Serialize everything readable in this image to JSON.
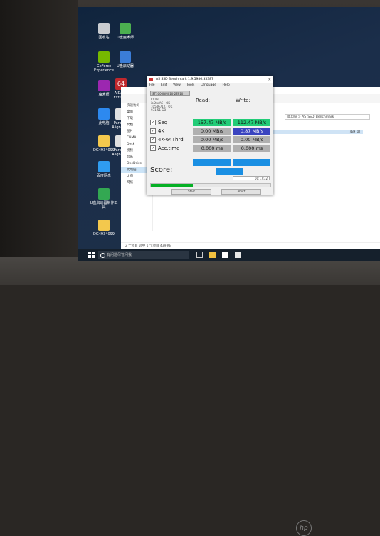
{
  "window": {
    "title": "AS SSD Benchmark 1.9.5986.35387"
  },
  "menu": [
    "File",
    "Edit",
    "View",
    "Tools",
    "Language",
    "Help"
  ],
  "drive": {
    "selected": "ST1000DM010-2EP10",
    "info": [
      "CC43",
      "iaStorAC - OK",
      "1054671K - OK",
      "931.51 GB"
    ]
  },
  "columns": {
    "read": "Read:",
    "write": "Write:"
  },
  "results": [
    {
      "label": "Seq",
      "read": "157.47 MB/s",
      "write": "112.47 MB/s"
    },
    {
      "label": "4K",
      "read": "0.00 MB/s",
      "write": "0.87 MB/s"
    },
    {
      "label": "4K-64Thrd",
      "read": "0.00 MB/s",
      "write": "0.00 MB/s"
    },
    {
      "label": "Acc.time",
      "read": "0.000 ms",
      "write": "0.000 ms"
    }
  ],
  "score_label": "Score:",
  "time": "00:17:32",
  "buttons": {
    "start": "Start",
    "abort": "Abort"
  },
  "progress_fraction": 0.35,
  "explorer": {
    "nav": [
      "快速访问",
      "桌面",
      "下载",
      "文档",
      "图片",
      "CHMA",
      "Desk",
      "视频",
      "音乐",
      "OneDrive",
      "此电脑",
      "U 盘",
      "网络"
    ],
    "path": "此电脑 > AS_SSD_Benchmark",
    "row_size": "439 KB",
    "status": "2 个项目   选中 1 个项目  439 KB"
  },
  "desktop_icons": [
    {
      "label": "回收站"
    },
    {
      "label": "U盘魔术师"
    },
    {
      "label": "GeForce Experience"
    },
    {
      "label": "U盘启动器"
    },
    {
      "label": "魔术师"
    },
    {
      "label": "AIDA64 Extreme"
    },
    {
      "label": "此电脑"
    },
    {
      "label": "Paragon Alignment"
    },
    {
      "label": "DG4934099"
    },
    {
      "label": "Paragon Alignment"
    },
    {
      "label": "百度网盘"
    },
    {
      "label": "U盘启动器制作工具"
    },
    {
      "label": "DG4934099"
    }
  ],
  "taskbar": {
    "search_placeholder": "有问题尽管问我"
  },
  "colors": {
    "read_seq": "#22cc77",
    "write_seq": "#22cc77",
    "write_4k": "#3a44c0",
    "zero": "#b0b0b0",
    "score": "#1a8fe3",
    "progress": "#06b025"
  }
}
